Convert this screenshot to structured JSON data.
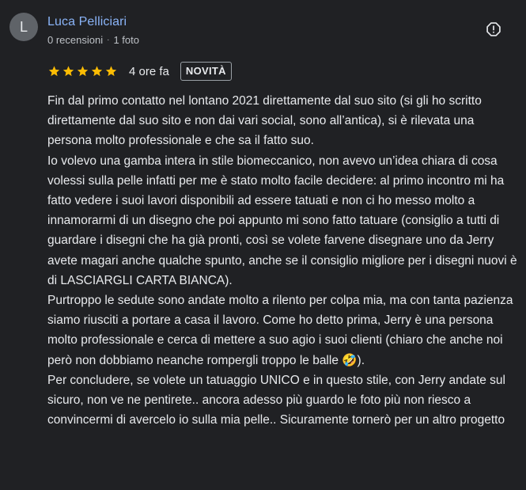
{
  "review": {
    "avatar_initial": "L",
    "author_name": "Luca Pelliciari",
    "reviews_count": "0 recensioni",
    "separator": "·",
    "photos_count": "1 foto",
    "stars": 5,
    "star_color": "#fbbc04",
    "time_ago": "4 ore fa",
    "badge": "NOVITÀ",
    "report_icon": "report-flag-icon",
    "text": "Fin dal primo contatto nel lontano 2021 direttamente dal suo sito (si gli ho scritto direttamente dal suo sito e non dai vari social, sono all’antica), si è rilevata una persona molto professionale e che sa il fatto suo.\nIo volevo una gamba intera in stile biomeccanico, non avevo un’idea chiara di cosa volessi sulla pelle infatti per me è stato molto facile decidere: al primo incontro mi ha fatto vedere i suoi lavori disponibili ad essere tatuati e non ci ho messo molto a innamorarmi di un disegno che poi appunto mi sono fatto tatuare (consiglio a tutti di guardare i disegni che ha già pronti, così se volete farvene disegnare uno da Jerry avete magari anche qualche spunto, anche se il consiglio migliore per i disegni nuovi è di LASCIARGLI CARTA BIANCA).\nPurtroppo le sedute sono andate molto a rilento per colpa mia, ma con tanta pazienza siamo riusciti a portare a casa il lavoro. Come ho detto prima, Jerry è una persona molto professionale e cerca di mettere a suo agio i suoi clienti (chiaro che anche noi però non dobbiamo neanche rompergli troppo le balle 🤣).\nPer concludere, se volete un tatuaggio UNICO e in questo stile, con Jerry andate sul sicuro, non ve ne pentirete.. ancora adesso più guardo le foto più non riesco a convincermi di avercelo io sulla mia pelle.. Sicuramente tornerò per un altro progetto"
  }
}
